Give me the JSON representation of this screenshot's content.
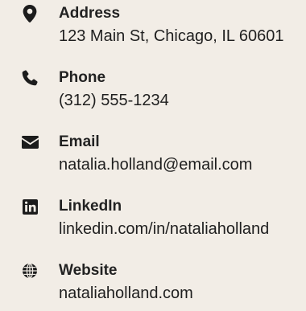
{
  "contacts": [
    {
      "icon": "map-pin-icon",
      "label": "Address",
      "value": "123 Main St, Chicago, IL 60601"
    },
    {
      "icon": "phone-icon",
      "label": "Phone",
      "value": "(312) 555-1234"
    },
    {
      "icon": "envelope-icon",
      "label": "Email",
      "value": "natalia.holland@email.com"
    },
    {
      "icon": "linkedin-icon",
      "label": "LinkedIn",
      "value": "linkedin.com/in/nataliaholland"
    },
    {
      "icon": "globe-icon",
      "label": "Website",
      "value": "nataliaholland.com"
    }
  ]
}
